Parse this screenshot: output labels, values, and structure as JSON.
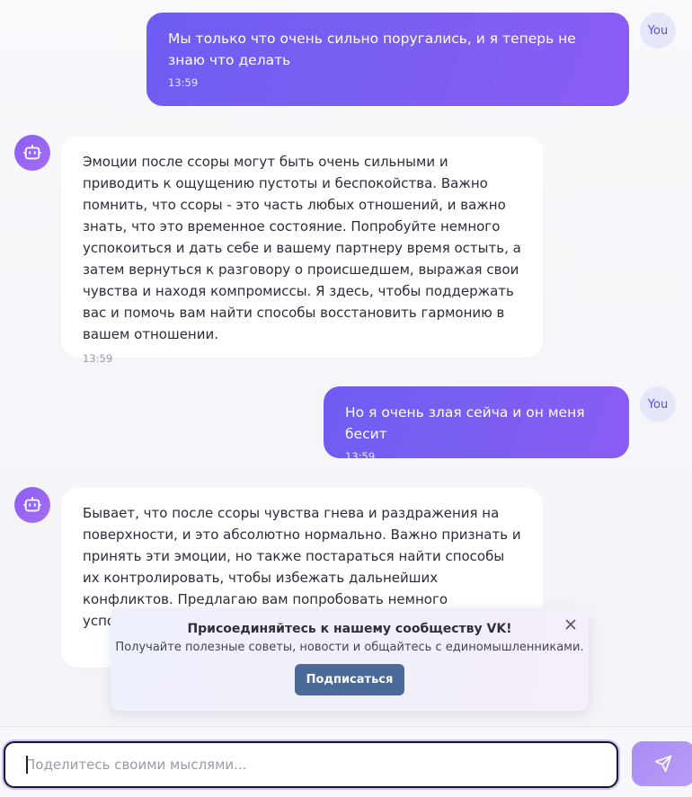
{
  "messages": [
    {
      "role": "user",
      "avatar_label": "You",
      "text": "Мы только что очень сильно поругались, и я теперь не знаю что делать",
      "time": "13:59"
    },
    {
      "role": "bot",
      "avatar_icon": "robot-icon",
      "text": "Эмоции после ссоры могут быть очень сильными и приводить к ощущению пустоты и беспокойства. Важно помнить, что ссоры - это часть любых отношений, и важно знать, что это временное состояние. Попробуйте немного успокоиться и дать себе и вашему партнеру время остыть, а затем вернуться к разговору о происшедшем, выражая свои чувства и находя компромиссы. Я здесь, чтобы поддержать вас и помочь вам найти способы восстановить гармонию в вашем отношении.",
      "time": "13:59"
    },
    {
      "role": "user",
      "avatar_label": "You",
      "text": "Но я очень злая сейча и он меня бесит",
      "time": "13:59"
    },
    {
      "role": "bot",
      "avatar_icon": "robot-icon",
      "text": "Бывает, что после ссоры чувства гнева и раздражения на поверхности, и это абсолютно нормально. Важно признать и принять эти эмоции, но также постараться найти способы их контролировать, чтобы избежать дальнейших конфликтов. Предлагаю вам попробовать немного успокоиться, можем"
    }
  ],
  "vk_banner": {
    "title": "Присоединяйтесь к нашему сообществу VK!",
    "subtitle": "Получайте полезные советы, новости и общайтесь с единомышленниками.",
    "button_label": "Подписаться",
    "close_icon": "close-icon"
  },
  "composer": {
    "placeholder": "Поделитесь своими мыслями...",
    "value": "",
    "send_icon": "send-icon"
  },
  "colors": {
    "user_bubble": "#7a5ff0",
    "bot_avatar": "#8b5cf6",
    "vk_button": "#4a6a98",
    "send_button": "#b09af5"
  }
}
